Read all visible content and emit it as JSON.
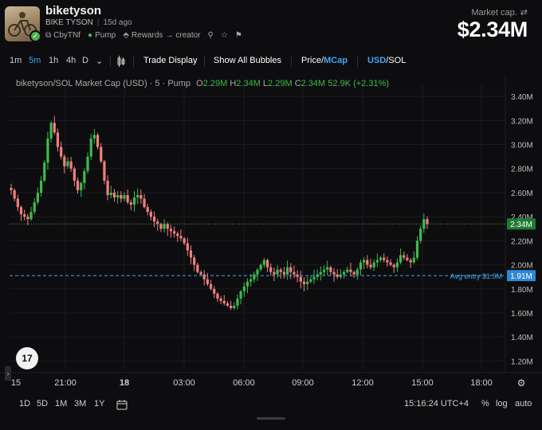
{
  "header": {
    "title": "biketyson",
    "fullname": "BIKE TYSON",
    "age": "15d ago",
    "address_short": "CbyTNf",
    "platform": "Pump",
    "rewards_label": "Rewards",
    "rewards_target": "creator",
    "market_cap_label": "Market cap.",
    "market_cap_value": "$2.34M"
  },
  "toolbar": {
    "intervals": [
      "1m",
      "5m",
      "1h",
      "4h",
      "D"
    ],
    "active_interval": "5m",
    "trade_display": "Trade Display",
    "show_bubbles": "Show All Bubbles",
    "price_label": "Price",
    "mcap_label": "MCap",
    "usd_label": "USD",
    "sol_label": "SOL"
  },
  "legend": {
    "title": "biketyson/SOL Market Cap (USD) · 5 · Pump",
    "o_label": "O",
    "o_val": "2.29M",
    "h_label": "H",
    "h_val": "2.34M",
    "l_label": "L",
    "l_val": "2.29M",
    "c_label": "C",
    "c_val": "2.34M",
    "change": "52.9K (+2.31%)"
  },
  "chart_data": {
    "type": "candlestick",
    "y_ticks": [
      "3.40M",
      "3.20M",
      "3.00M",
      "2.80M",
      "2.60M",
      "2.40M",
      "2.20M",
      "2.00M",
      "1.80M",
      "1.60M",
      "1.40M",
      "1.20M"
    ],
    "ylim": [
      1.13,
      3.5
    ],
    "x_ticks": [
      "15",
      "21:00",
      "18",
      "03:00",
      "06:00",
      "09:00",
      "12:00",
      "15:00",
      "18:00"
    ],
    "current_price_label": "2.34M",
    "current_price": 2.34,
    "avg_entry_label": "Avg entry $1.9M",
    "avg_entry_value_label": "1.91M",
    "avg_entry": 1.91,
    "colors": {
      "up": "#3fb950",
      "down": "#f08080",
      "grid": "#1c1c20",
      "avg": "#3fa7f5",
      "last": "#3fb950"
    },
    "close_series": [
      2.62,
      2.55,
      2.48,
      2.42,
      2.4,
      2.38,
      2.44,
      2.52,
      2.6,
      2.7,
      2.85,
      3.05,
      3.18,
      3.1,
      2.98,
      2.9,
      2.82,
      2.86,
      2.8,
      2.7,
      2.62,
      2.68,
      2.78,
      2.9,
      3.05,
      3.08,
      2.98,
      2.86,
      2.7,
      2.58,
      2.6,
      2.56,
      2.58,
      2.55,
      2.58,
      2.52,
      2.5,
      2.56,
      2.58,
      2.55,
      2.48,
      2.44,
      2.4,
      2.36,
      2.34,
      2.3,
      2.34,
      2.3,
      2.28,
      2.26,
      2.24,
      2.22,
      2.18,
      2.12,
      2.06,
      2.0,
      1.94,
      1.92,
      1.88,
      1.84,
      1.8,
      1.76,
      1.72,
      1.7,
      1.68,
      1.66,
      1.64,
      1.66,
      1.72,
      1.78,
      1.82,
      1.86,
      1.88,
      1.92,
      1.96,
      2.0,
      2.04,
      1.98,
      1.94,
      1.92,
      1.96,
      1.94,
      1.92,
      1.98,
      1.94,
      1.92,
      1.9,
      1.86,
      1.84,
      1.86,
      1.88,
      1.9,
      1.92,
      1.94,
      1.96,
      1.98,
      1.94,
      1.92,
      1.9,
      1.92,
      1.94,
      1.96,
      1.94,
      1.92,
      1.96,
      2.02,
      2.04,
      2.0,
      1.98,
      2.02,
      2.04,
      2.06,
      2.04,
      2.02,
      2.0,
      1.98,
      2.02,
      2.08,
      2.06,
      2.04,
      2.02,
      2.06,
      2.2,
      2.3,
      2.38,
      2.34
    ]
  },
  "bottom": {
    "ranges": [
      "1D",
      "5D",
      "1M",
      "3M",
      "1Y"
    ],
    "clock": "15:16:24 UTC+4",
    "percent": "%",
    "log": "log",
    "auto": "auto"
  }
}
